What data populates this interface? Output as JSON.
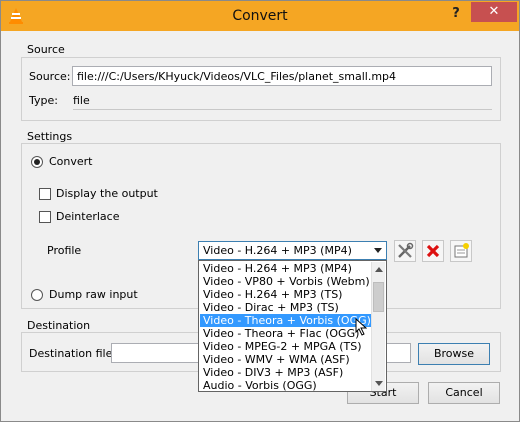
{
  "window": {
    "title": "Convert",
    "help_glyph": "?",
    "close_glyph": "✕"
  },
  "source": {
    "group_title": "Source",
    "source_label": "Source:",
    "source_value": "file:///C:/Users/KHyuck/Videos/VLC_Files/planet_small.mp4",
    "type_label": "Type:",
    "type_value": "file"
  },
  "settings": {
    "group_title": "Settings",
    "convert_label": "Convert",
    "display_output_label": "Display the output",
    "deinterlace_label": "Deinterlace",
    "profile_label": "Profile",
    "profile_selected": "Video - H.264 + MP3 (MP4)",
    "dump_raw_label": "Dump raw input",
    "profile_options": [
      "Video - H.264 + MP3 (MP4)",
      "Video - VP80 + Vorbis (Webm)",
      "Video - H.264 + MP3 (TS)",
      "Video - Dirac + MP3 (TS)",
      "Video - Theora + Vorbis (OGG)",
      "Video - Theora + Flac (OGG)",
      "Video - MPEG-2 + MPGA (TS)",
      "Video - WMV + WMA (ASF)",
      "Video - DIV3 + MP3 (ASF)",
      "Audio - Vorbis (OGG)"
    ],
    "highlighted_index": 4
  },
  "destination": {
    "group_title": "Destination",
    "file_label": "Destination file:",
    "file_value": "",
    "browse_label": "Browse"
  },
  "buttons": {
    "start_label": "Start",
    "cancel_label": "Cancel"
  },
  "icons": {
    "app": "vlc-cone-icon",
    "edit": "wrench-screwdriver-icon",
    "delete": "red-x-icon",
    "new": "new-profile-icon"
  }
}
